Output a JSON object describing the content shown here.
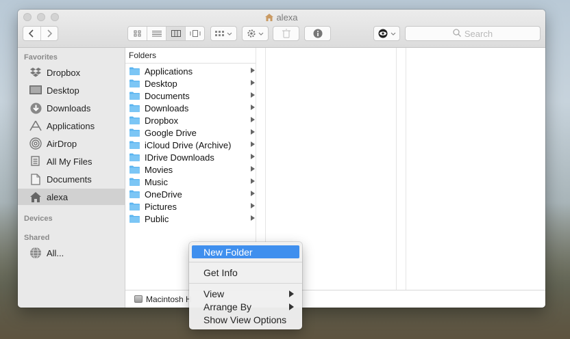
{
  "window": {
    "title": "alexa"
  },
  "toolbar": {
    "search_placeholder": "Search"
  },
  "sidebar": {
    "sections": {
      "favorites": "Favorites",
      "devices": "Devices",
      "shared": "Shared"
    },
    "favorites": [
      {
        "label": "Dropbox",
        "icon": "dropbox-icon"
      },
      {
        "label": "Desktop",
        "icon": "desktop-icon"
      },
      {
        "label": "Downloads",
        "icon": "downloads-icon"
      },
      {
        "label": "Applications",
        "icon": "applications-icon"
      },
      {
        "label": "AirDrop",
        "icon": "airdrop-icon"
      },
      {
        "label": "All My Files",
        "icon": "all-my-files-icon"
      },
      {
        "label": "Documents",
        "icon": "documents-icon"
      },
      {
        "label": "alexa",
        "icon": "home-icon",
        "selected": true
      }
    ],
    "shared": [
      {
        "label": "All...",
        "icon": "network-globe-icon"
      }
    ]
  },
  "column": {
    "header": "Folders",
    "items": [
      "Applications",
      "Desktop",
      "Documents",
      "Downloads",
      "Dropbox",
      "Google Drive",
      "iCloud Drive (Archive)",
      "IDrive Downloads",
      "Movies",
      "Music",
      "OneDrive",
      "Pictures",
      "Public"
    ]
  },
  "pathbar": {
    "disk": "Macintosh H"
  },
  "context_menu": {
    "items": {
      "new_folder": "New Folder",
      "get_info": "Get Info",
      "view": "View",
      "arrange_by": "Arrange By",
      "show_view_options": "Show View Options"
    }
  },
  "colors": {
    "highlight": "#3f8fee",
    "folder": "#5ab4f0",
    "sidebar_bg": "#e9e9e9"
  }
}
